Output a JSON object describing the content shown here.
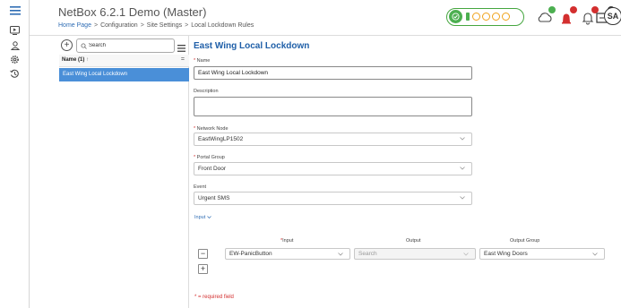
{
  "header": {
    "app_title": "NetBox 6.2.1 Demo (Master)",
    "breadcrumb": [
      "Home Page",
      "Configuration",
      "Site Settings",
      "Local Lockdown Rules"
    ],
    "breadcrumb_separator": ">",
    "user_initials": "SA",
    "notifications": [
      {
        "icon": "cloud-icon",
        "badge_color": "#4caf50"
      },
      {
        "icon": "alarm-icon",
        "badge_color": "#d32f2f"
      },
      {
        "icon": "bell-icon",
        "badge_color": "#d32f2f"
      },
      {
        "icon": "message-icon",
        "badge_color": "#333333"
      }
    ]
  },
  "rail": {
    "items": [
      {
        "icon": "hamburger-menu-icon"
      },
      {
        "icon": "play-monitor-icon"
      },
      {
        "icon": "user-icon"
      },
      {
        "icon": "gear-icon"
      },
      {
        "icon": "history-icon"
      }
    ]
  },
  "list": {
    "search_placeholder": "Search",
    "column_header": "Name (1)",
    "sort_indicator": "↑",
    "items": [
      {
        "label": "East Wing Local Lockdown",
        "selected": true
      }
    ]
  },
  "form": {
    "title": "East Wing Local Lockdown",
    "required_mark": "*",
    "name_label": "Name",
    "name_value": "East Wing Local Lockdown",
    "description_label": "Description",
    "description_value": "",
    "network_node_label": "Network Node",
    "network_node_value": "EastWingLP1502",
    "portal_group_label": "Portal Group",
    "portal_group_value": "Front Door",
    "event_label": "Event",
    "event_value": "Urgent SMS",
    "input_toggle": "Input",
    "columns": {
      "input": "Input",
      "output": "Output",
      "output_group": "Output Group"
    },
    "rows": [
      {
        "input": "EW-PanicButton",
        "output_placeholder": "Search",
        "output_group": "East Wing Doors"
      }
    ],
    "remove_label": "−",
    "add_label": "+",
    "required_note": "* = required field"
  },
  "colors": {
    "accent": "#1f5fa8",
    "selection": "#4a8fd8",
    "status_green": "#4caf50",
    "status_orange": "#f0a21a",
    "required_red": "#d32f2f"
  }
}
